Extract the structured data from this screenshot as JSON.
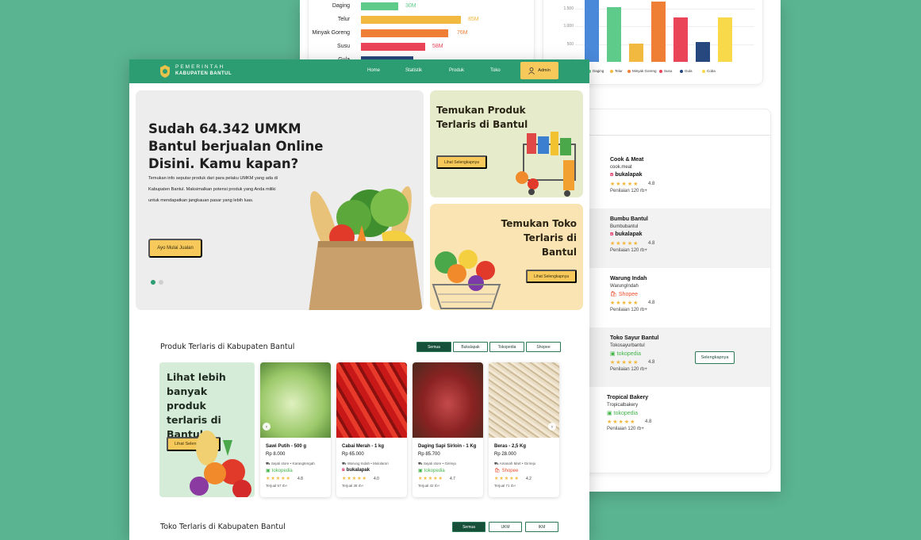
{
  "colors": {
    "background": "#5ab491",
    "navbar": "#2c9c72",
    "accent": "#f6c95a",
    "dark_green": "#16503a",
    "star": "#f4b63a",
    "bukalapak": "#e31e52",
    "tokopedia": "#42b549",
    "shopee": "#ee4d2d"
  },
  "back_page": {
    "hbar_chart": {
      "rows": [
        {
          "label": "Daging",
          "value_label": "30M",
          "color": "#5ecb8b"
        },
        {
          "label": "Telur",
          "value_label": "85M",
          "color": "#f1b93f"
        },
        {
          "label": "Minyak Goreng",
          "value_label": "76M",
          "color": "#f07f36"
        },
        {
          "label": "Susu",
          "value_label": "58M",
          "color": "#ea4458"
        },
        {
          "label": "Gula",
          "value_label": "",
          "color": "#26487e"
        }
      ]
    },
    "vbar_chart": {
      "ticks": [
        "1.500",
        "1.000",
        "500"
      ],
      "legend": [
        {
          "label": "Beras",
          "color": "#4a88d9"
        },
        {
          "label": "Daging",
          "color": "#5ecb8b"
        },
        {
          "label": "Telur",
          "color": "#f1b93f"
        },
        {
          "label": "Minyak Goreng",
          "color": "#f07f36"
        },
        {
          "label": "Susu",
          "color": "#ea4458"
        },
        {
          "label": "Gula",
          "color": "#26487e"
        },
        {
          "label": "Coba",
          "color": "#f7d94a"
        }
      ]
    },
    "stores": [
      {
        "name": "Cook & Meat",
        "handle": "cook.meat",
        "platform": "bukalapak",
        "platform_label": "bukalapak",
        "stars": "★★★★★",
        "rating": "4.8",
        "reviews": "Penilaian 120 rb+"
      },
      {
        "name": "Bumbu Bantul",
        "handle": "Bumbubantul",
        "platform": "bukalapak",
        "platform_label": "bukalapak",
        "stars": "★★★★★",
        "rating": "4.8",
        "reviews": "Penilaian 120 rb+"
      },
      {
        "name": "Warung Indah",
        "handle": "WarungIndah",
        "platform": "shopee",
        "platform_label": "Shopee",
        "stars": "★★★★★",
        "rating": "4.8",
        "reviews": "Penilaian 120 rb+"
      },
      {
        "name": "Toko Sayur Bantul",
        "handle": "Tokosayurbantul",
        "platform": "tokopedia",
        "platform_label": "tokopedia",
        "stars": "★★★★★",
        "rating": "4.8",
        "reviews": "Penilaian 120 rb+"
      },
      {
        "name": "Tropical Bakery",
        "handle": "Tropicalbakery",
        "platform": "tokopedia",
        "platform_label": "tokopedia",
        "stars": "★★★★★",
        "rating": "4.8",
        "reviews": "Penilaian 120 rb+"
      }
    ],
    "store_more_label": "Selengkapnya"
  },
  "nav": {
    "brand_top": "PEMERINTAH",
    "brand_bottom": "KABUPATEN BANTUL",
    "links": [
      "Home",
      "Statistik",
      "Produk",
      "Toko"
    ],
    "admin_label": "Admin"
  },
  "hero": {
    "title": "Sudah 64.342 UMKM Bantul berjualan Online Disini. Kamu kapan?",
    "description": "Temukan info seputar produk dari para pelaku UMKM yang ada di Kabupaten Bantul. Maksimalkan potensi produk yang Anda miliki untuk mendapatkan jangkauan pasar yang lebih luas.",
    "cta": "Ayo Mulai Jualan"
  },
  "promos": {
    "product_title": "Temukan Produk Terlaris di Bantul",
    "product_cta": "Lihat Selengkapnya",
    "store_title": "Temukan Toko Terlaris di Bantul",
    "store_cta": "Lihat Selengkapnya"
  },
  "products_section": {
    "title": "Produk Terlaris di Kabupaten Bantul",
    "filters": [
      "Semua",
      "Bukalapak",
      "Tokopedia",
      "Shopee"
    ],
    "more_title": "Lihat lebih banyak produk terlaris di Bantul",
    "more_cta": "Lihat Selengkapnya",
    "items": [
      {
        "name": "Sawi Putih - 500 g",
        "price": "Rp 8.000",
        "store": "Sejati store • Karangtengah",
        "platform": "tokopedia",
        "platform_label": "tokopedia",
        "stars": "★★★★★",
        "rating": "4.8",
        "sold": "Terjual 57 rb+"
      },
      {
        "name": "Cabai Merah - 1 kg",
        "price": "Rp 65.000",
        "store": "Warung Indah • Mulolarsri",
        "platform": "bukalapak",
        "platform_label": "bukalapak",
        "stars": "★★★★★",
        "rating": "4.0",
        "sold": "Terjual 38 rb+"
      },
      {
        "name": "Daging Sapi Sirloin - 1 Kg",
        "price": "Rp 85.700",
        "store": "Sejati store • Girirejo",
        "platform": "tokopedia",
        "platform_label": "tokopedia",
        "stars": "★★★★★",
        "rating": "4.7",
        "sold": "Terjual 42 rb+"
      },
      {
        "name": "Beras - 2,5 Kg",
        "price": "Rp 28.000",
        "store": "Amanah Mart • Girirejo",
        "platform": "shopee",
        "platform_label": "Shopee",
        "stars": "★★★★★",
        "rating": "4.2",
        "sold": "Terjual 71 rb+"
      }
    ]
  },
  "stores_section": {
    "title": "Toko Terlaris di Kabupaten Bantul",
    "filters": [
      "Semua",
      "UKM",
      "IKM"
    ]
  }
}
